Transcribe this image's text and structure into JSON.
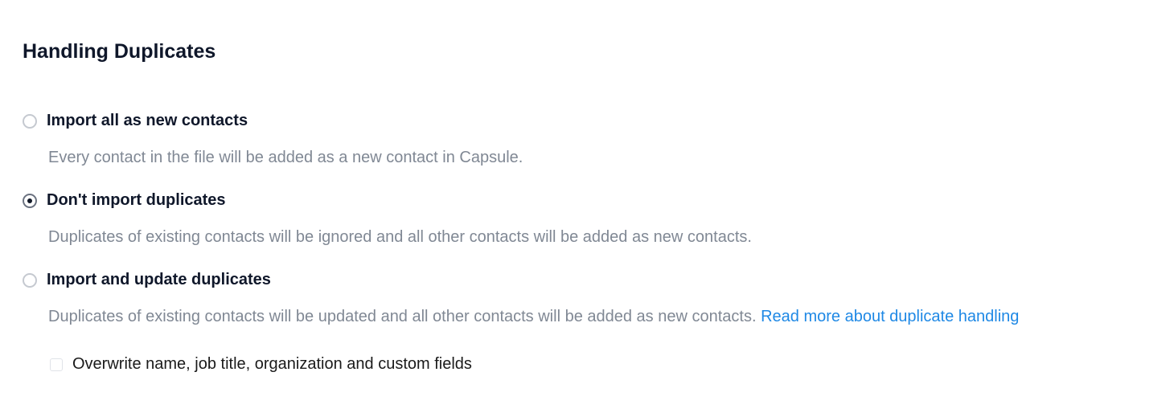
{
  "section": {
    "title": "Handling Duplicates"
  },
  "options": [
    {
      "label": "Import all as new contacts",
      "description": "Every contact in the file will be added as a new contact in Capsule.",
      "selected": false
    },
    {
      "label": "Don't import duplicates",
      "description": "Duplicates of existing contacts will be ignored and all other contacts will be added as new contacts.",
      "selected": true
    },
    {
      "label": "Import and update duplicates",
      "description": "Duplicates of existing contacts will be updated and all other contacts will be added as new contacts. ",
      "link_text": "Read more about duplicate handling",
      "selected": false
    }
  ],
  "sub_option": {
    "label": "Overwrite name, job title, organization and custom fields",
    "checked": false
  }
}
